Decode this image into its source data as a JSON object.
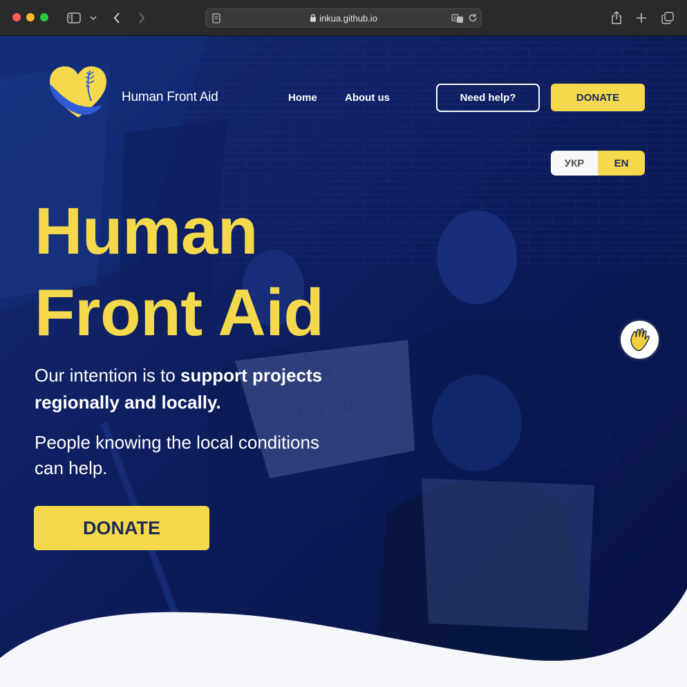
{
  "browser": {
    "url": "inkua.github.io"
  },
  "header": {
    "brand": "Human Front Aid",
    "nav": [
      {
        "label": "Home"
      },
      {
        "label": "About us"
      }
    ],
    "help_label": "Need help?",
    "donate_label": "DONATE"
  },
  "language": {
    "options": [
      "УКР",
      "EN"
    ],
    "selected": "EN"
  },
  "hero": {
    "title_line1": "Human",
    "title_line2": "Front Aid",
    "intent_plain": "Our intention is to ",
    "intent_bold": "support projects regionally and locally.",
    "people": "People knowing the local conditions can help.",
    "donate_label": "DONATE"
  },
  "colors": {
    "accent": "#f5d94c",
    "navy": "#1b2a55",
    "hero_bg": "#0f2063"
  },
  "icons": {
    "wave_button": "waving-hand-icon"
  }
}
